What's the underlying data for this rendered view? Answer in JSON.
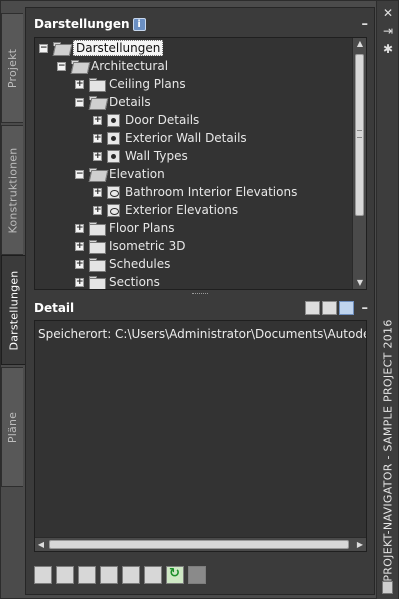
{
  "palette": {
    "title": "PROJEKT-NAVIGATOR - SAMPLE PROJECT 2016",
    "controls": [
      "close-icon",
      "autohide-icon",
      "properties-icon"
    ]
  },
  "tabs": [
    {
      "label": "Projekt",
      "active": false
    },
    {
      "label": "Konstruktionen",
      "active": false
    },
    {
      "label": "Darstellungen",
      "active": true
    },
    {
      "label": "Pläne",
      "active": false
    }
  ],
  "views_panel": {
    "title": "Darstellungen",
    "info_icon": "i",
    "collapse": "–",
    "tree": [
      {
        "label": "Darstellungen",
        "level": 0,
        "icon": "folder-open-icon",
        "state": "expanded",
        "selected": true
      },
      {
        "label": "Architectural",
        "level": 1,
        "icon": "folder-open-icon",
        "state": "expanded"
      },
      {
        "label": "Ceiling Plans",
        "level": 2,
        "icon": "folder-icon",
        "state": "collapsed"
      },
      {
        "label": "Details",
        "level": 2,
        "icon": "folder-open-icon",
        "state": "expanded"
      },
      {
        "label": "Door Details",
        "level": 3,
        "icon": "detail-view-icon",
        "state": "collapsed"
      },
      {
        "label": "Exterior Wall Details",
        "level": 3,
        "icon": "detail-view-icon",
        "state": "collapsed"
      },
      {
        "label": "Wall Types",
        "level": 3,
        "icon": "detail-view-icon",
        "state": "collapsed"
      },
      {
        "label": "Elevation",
        "level": 2,
        "icon": "folder-open-icon",
        "state": "expanded"
      },
      {
        "label": "Bathroom Interior Elevations",
        "level": 3,
        "icon": "elevation-view-icon",
        "state": "collapsed"
      },
      {
        "label": "Exterior Elevations",
        "level": 3,
        "icon": "elevation-view-icon",
        "state": "collapsed"
      },
      {
        "label": "Floor Plans",
        "level": 2,
        "icon": "folder-icon",
        "state": "collapsed"
      },
      {
        "label": "Isometric 3D",
        "level": 2,
        "icon": "folder-icon",
        "state": "collapsed"
      },
      {
        "label": "Schedules",
        "level": 2,
        "icon": "folder-icon",
        "state": "collapsed"
      },
      {
        "label": "Sections",
        "level": 2,
        "icon": "folder-icon",
        "state": "collapsed"
      }
    ]
  },
  "detail_panel": {
    "title": "Detail",
    "collapse": "–",
    "header_icons": [
      "preview-icon",
      "detail-list-icon",
      "image-view-icon"
    ],
    "text": "Speicherort: C:\\Users\\Administrator\\Documents\\Autodesk\\Eig"
  },
  "toolbar": {
    "buttons": [
      "new-view-icon",
      "new-category-icon",
      "open-view-icon",
      "clipboard-icon",
      "regenerate-icon",
      "table-icon",
      "refresh-icon",
      "repath-icon"
    ]
  }
}
